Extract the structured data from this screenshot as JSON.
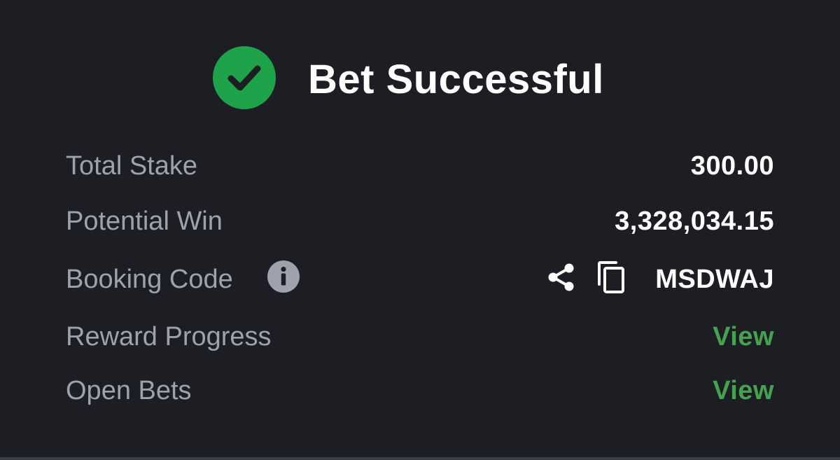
{
  "header": {
    "title": "Bet Successful",
    "icon": "check-circle-icon",
    "accent_color": "#1fa34a"
  },
  "summary": {
    "total_stake": {
      "label": "Total Stake",
      "value": "300.00"
    },
    "potential_win": {
      "label": "Potential Win",
      "value": "3,328,034.15"
    },
    "booking_code": {
      "label": "Booking Code",
      "value": "MSDWAJ",
      "info_icon": "info-icon",
      "share_icon": "share-icon",
      "copy_icon": "copy-icon"
    },
    "reward_progress": {
      "label": "Reward Progress",
      "link": "View"
    },
    "open_bets": {
      "label": "Open Bets",
      "link": "View"
    }
  },
  "colors": {
    "background": "#1c1e23",
    "label": "#9ea2ad",
    "value": "#ffffff",
    "link": "#43a34e"
  }
}
